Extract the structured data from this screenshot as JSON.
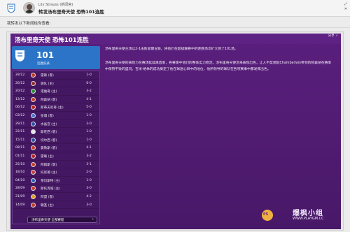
{
  "header": {
    "sender": "Lily Strauss (新闻官)",
    "title": "转发汤布里奇天使 恐怖101连胜",
    "window_controls": [
      "⤢",
      "✕"
    ]
  },
  "subbar": {
    "text": "我转发以下新闻给你查看:"
  },
  "article": {
    "title": "汤布里奇天使 恐怖101连胜",
    "share_label": "分享 ✓",
    "stat": {
      "number": "101",
      "label": "连胜纪录"
    },
    "paragraph_1": "汤布里奇天使主场以2-1击败星期五联，将他们在超级联赛中的连胜场次扩大到了101场。",
    "paragraph_2": "汤布里奇天使的表现力在赛场延续再造率，各赛事中他们的整体实力稳定。汤布里奇天使近来表现出色，让人不禁想起Chamberlain带领的阿森纳在赛季中保持不败的盛况。吉米·格林的成功奠定了他在球迷心目中的地位，他所领导的球队在各项赛事中都发挥出色。",
    "matches": [
      {
        "date": "28/12",
        "opponent": "雷斯 (客)",
        "score": "1-0",
        "badge_color": "#c0392b"
      },
      {
        "date": "26/12",
        "opponent": "驿队 (主)",
        "score": "6-0",
        "badge_color": "#8e2a2a"
      },
      {
        "date": "20/12",
        "opponent": "诺维奇 (主)",
        "score": "3-2",
        "badge_color": "#2e8b3a"
      },
      {
        "date": "13/12",
        "opponent": "阿森纳 (客)",
        "score": "4-1",
        "badge_color": "#c0392b"
      },
      {
        "date": "06/12",
        "opponent": "斯蒂夫尼奇 (主)",
        "score": "5-0",
        "badge_color": "#b22222"
      },
      {
        "date": "03/12",
        "opponent": "星城 (客)",
        "score": "1-0",
        "badge_color": "#4a6fd1"
      },
      {
        "date": "29/11",
        "opponent": "水晶宫 (主)",
        "score": "3-0",
        "badge_color": "#2e4fa8"
      },
      {
        "date": "22/11",
        "opponent": "斯旺西 (客)",
        "score": "1-0",
        "badge_color": "#e6e6e6"
      },
      {
        "date": "15/11",
        "opponent": "切尔西 (客)",
        "score": "1-0",
        "badge_color": "#2a4fa0"
      },
      {
        "date": "08/11",
        "opponent": "曼勒斯 (客)",
        "score": "4-1",
        "badge_color": "#c0392b"
      },
      {
        "date": "01/11",
        "opponent": "雷联 (主)",
        "score": "3-2",
        "badge_color": "#b22222"
      },
      {
        "date": "25/10",
        "opponent": "阿姆斯 (客)",
        "score": "3-1",
        "badge_color": "#c0392b"
      },
      {
        "date": "18/10",
        "opponent": "托尼德 (主)",
        "score": "2-0",
        "badge_color": "#c04040"
      },
      {
        "date": "04/10",
        "opponent": "莱切斯特 (主)",
        "score": "1-0",
        "badge_color": "#2a5fb0"
      },
      {
        "date": "28/09",
        "opponent": "斯托克城 (主)",
        "score": "3-0",
        "badge_color": "#c0392b"
      },
      {
        "date": "21/09",
        "opponent": "阿盟 (客)",
        "score": "4-2",
        "badge_color": "#e0a020"
      },
      {
        "date": "14/09",
        "opponent": "朝圣 (主)",
        "score": "3-0",
        "badge_color": "#c0392b"
      }
    ],
    "more_button_label": "汤布里奇天使 全部赛程"
  },
  "watermark": {
    "logo_text": "PS",
    "title": "爆枫小组",
    "url": "WWW.PLAYGM.CC"
  },
  "colors": {
    "card_purple": "#5a1f7d",
    "stat_blue": "#2b74c7"
  }
}
